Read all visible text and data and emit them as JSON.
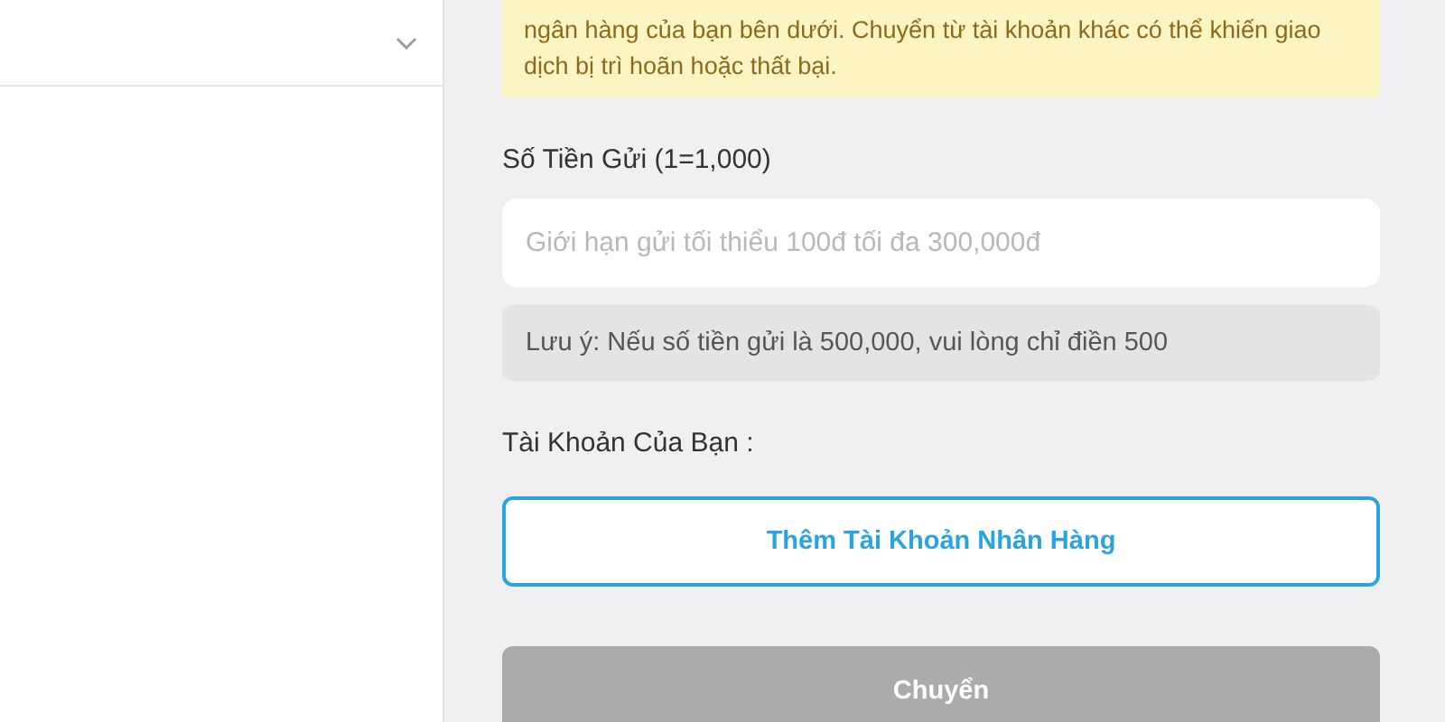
{
  "notice": {
    "text": "ngân hàng của bạn bên dưới. Chuyển từ tài khoản khác có thể khiến giao dịch bị trì hoãn hoặc thất bại."
  },
  "amount": {
    "label": "Số Tiền Gửi (1=1,000)",
    "placeholder": "Giới hạn gửi tối thiểu 100đ tối đa 300,000đ",
    "hint": "Lưu ý: Nếu số tiền gửi là 500,000, vui lòng chỉ điền 500"
  },
  "account": {
    "label": "Tài Khoản Của Bạn :",
    "add_button": "Thêm Tài Khoản Nhân Hàng"
  },
  "submit": {
    "label": "Chuyển",
    "disabled": true
  }
}
